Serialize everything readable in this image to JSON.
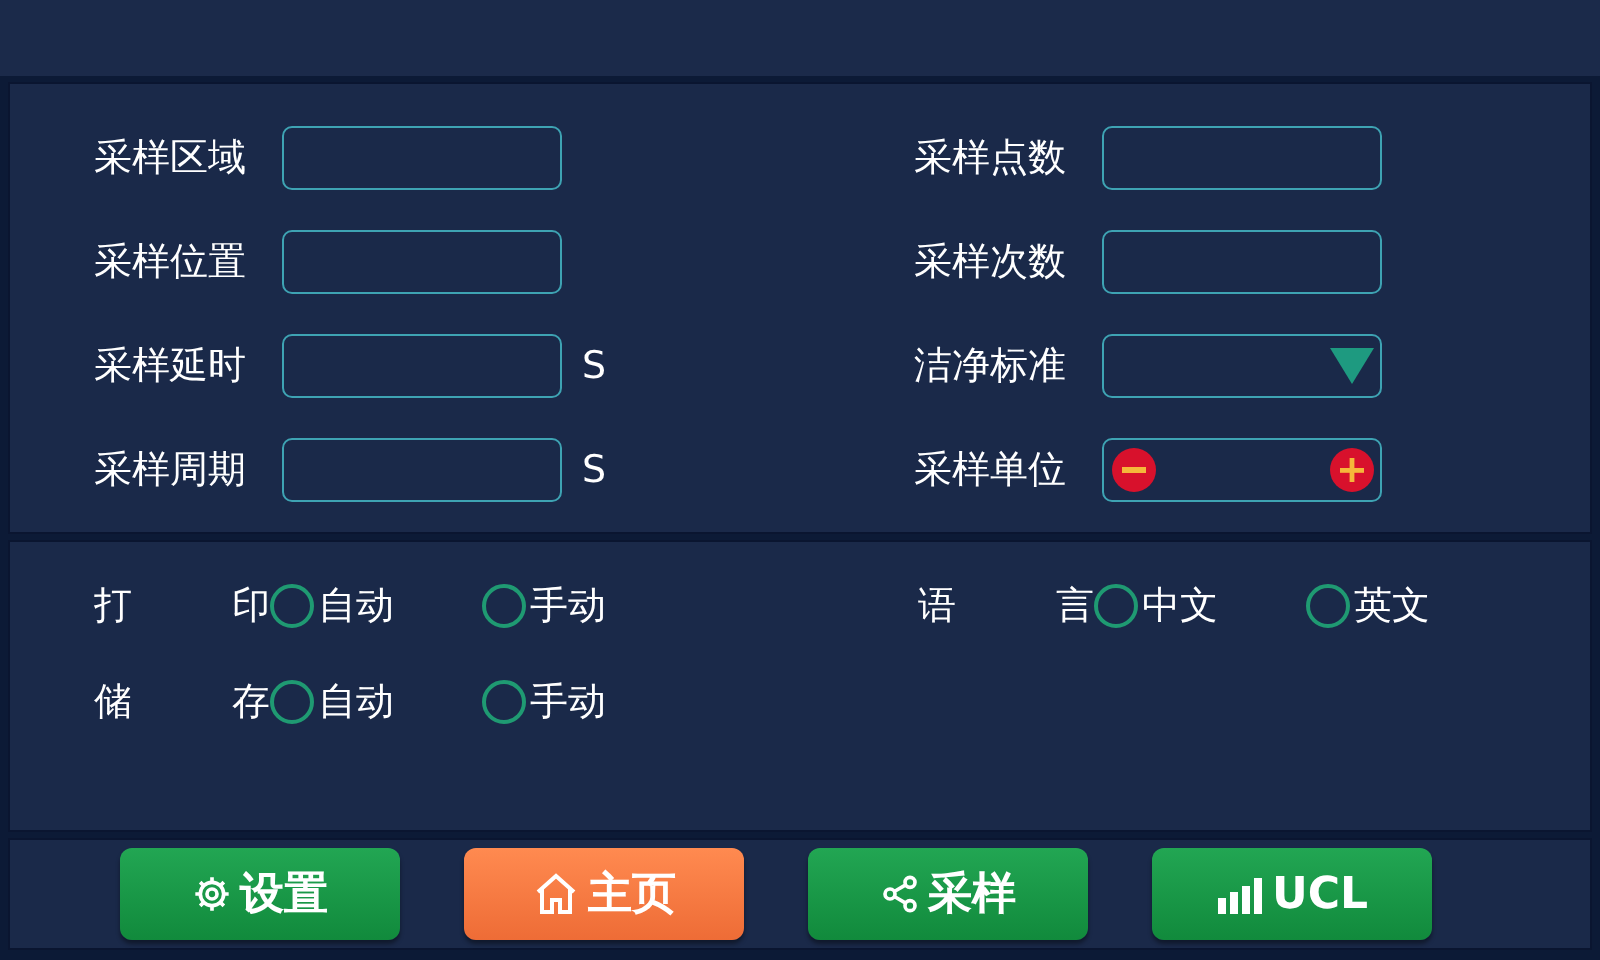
{
  "fields_left": [
    {
      "label": "采样区域",
      "kind": "text"
    },
    {
      "label": "采样位置",
      "kind": "text"
    },
    {
      "label": "采样延时",
      "kind": "text",
      "unit": "S"
    },
    {
      "label": "采样周期",
      "kind": "text",
      "unit": "S"
    }
  ],
  "fields_right": [
    {
      "label": "采样点数",
      "kind": "text"
    },
    {
      "label": "采样次数",
      "kind": "text"
    },
    {
      "label": "洁净标准",
      "kind": "select"
    },
    {
      "label": "采样单位",
      "kind": "stepper"
    }
  ],
  "options_left": [
    {
      "label": "打 印",
      "choices": [
        {
          "label": "自动",
          "selected": false
        },
        {
          "label": "手动",
          "selected": false
        }
      ]
    },
    {
      "label": "储 存",
      "choices": [
        {
          "label": "自动",
          "selected": false
        },
        {
          "label": "手动",
          "selected": false
        }
      ]
    }
  ],
  "options_right": [
    {
      "label": "语 言",
      "choices": [
        {
          "label": "中文",
          "selected": false
        },
        {
          "label": "英文",
          "selected": false
        }
      ]
    }
  ],
  "nav": [
    {
      "label": "设置",
      "kind": "settings",
      "selected": false
    },
    {
      "label": "主页",
      "kind": "home",
      "selected": true
    },
    {
      "label": "采样",
      "kind": "share",
      "selected": false
    },
    {
      "label": "UCL",
      "kind": "chart",
      "selected": false
    }
  ]
}
